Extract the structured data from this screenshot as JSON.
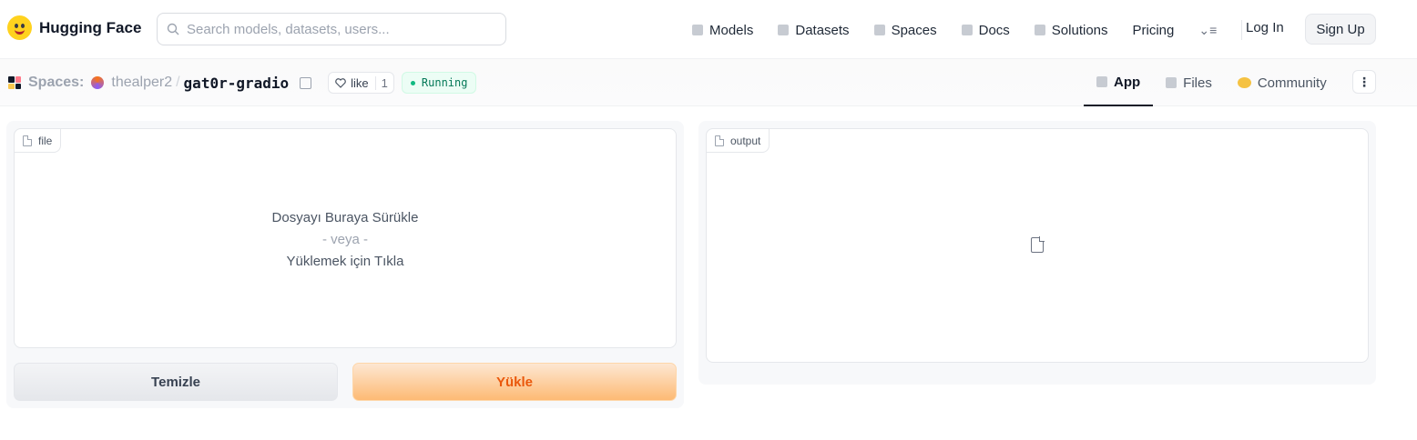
{
  "nav": {
    "brand": "Hugging Face",
    "search_placeholder": "Search models, datasets, users...",
    "links": [
      "Models",
      "Datasets",
      "Spaces",
      "Docs",
      "Solutions",
      "Pricing"
    ],
    "login": "Log In",
    "signup": "Sign Up"
  },
  "space": {
    "section_label": "Spaces:",
    "owner": "thealper2",
    "separator": "/",
    "name": "gat0r-gradio",
    "like_label": "like",
    "like_count": "1",
    "status": "Running",
    "tabs": [
      "App",
      "Files",
      "Community"
    ],
    "more_label": "⋮"
  },
  "app": {
    "file_label": "file",
    "drop_line1": "Dosyayı Buraya Sürükle",
    "drop_or": "- veya -",
    "drop_line2": "Yüklemek için Tıkla",
    "output_label": "output",
    "clear_button": "Temizle",
    "submit_button": "Yükle"
  }
}
